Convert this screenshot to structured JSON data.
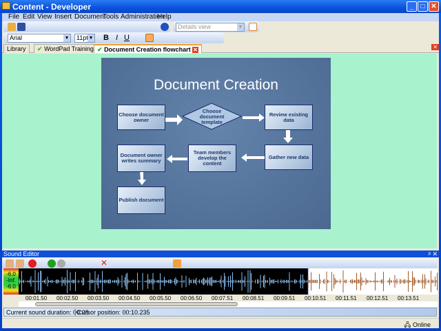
{
  "window": {
    "title": "Content - Developer",
    "min": "_",
    "max": "□",
    "close": "✕"
  },
  "menu": [
    "File",
    "Edit",
    "View",
    "Insert",
    "Document",
    "Tools",
    "Administration",
    "Help"
  ],
  "toolbar": {
    "view_combo": "Details view",
    "font": "Arial",
    "size": "11pt",
    "bold": "B",
    "italic": "I",
    "underline": "U"
  },
  "tabs": [
    {
      "label": "Library"
    },
    {
      "label": "WordPad Training"
    },
    {
      "label": "Document Creation flowchart"
    }
  ],
  "slide": {
    "title": "Document Creation",
    "nodes": [
      "Choose document owner",
      "Choose document template",
      "Review existing data",
      "Gather new data",
      "Team members develop the content",
      "Document owner writes summary",
      "Publish document"
    ]
  },
  "sound": {
    "title": "Sound Editor",
    "pin": "ᵖ",
    "close": "✕",
    "meter": [
      "-6.0",
      "-Inf.",
      "-6.0"
    ],
    "ticks": [
      "00:01.50",
      "00:02.50",
      "00:03.50",
      "00:04.50",
      "00:05.50",
      "00:06.50",
      "00:07.51",
      "00:08.51",
      "00:09.51",
      "00:10.51",
      "00:11.51",
      "00:12.51",
      "00:13.51"
    ],
    "duration": "Current sound duration: 00:28",
    "cursor": "Cursor position: 00:10.235",
    "played_fraction": 0.69
  },
  "statusbar": {
    "online": "Online"
  }
}
